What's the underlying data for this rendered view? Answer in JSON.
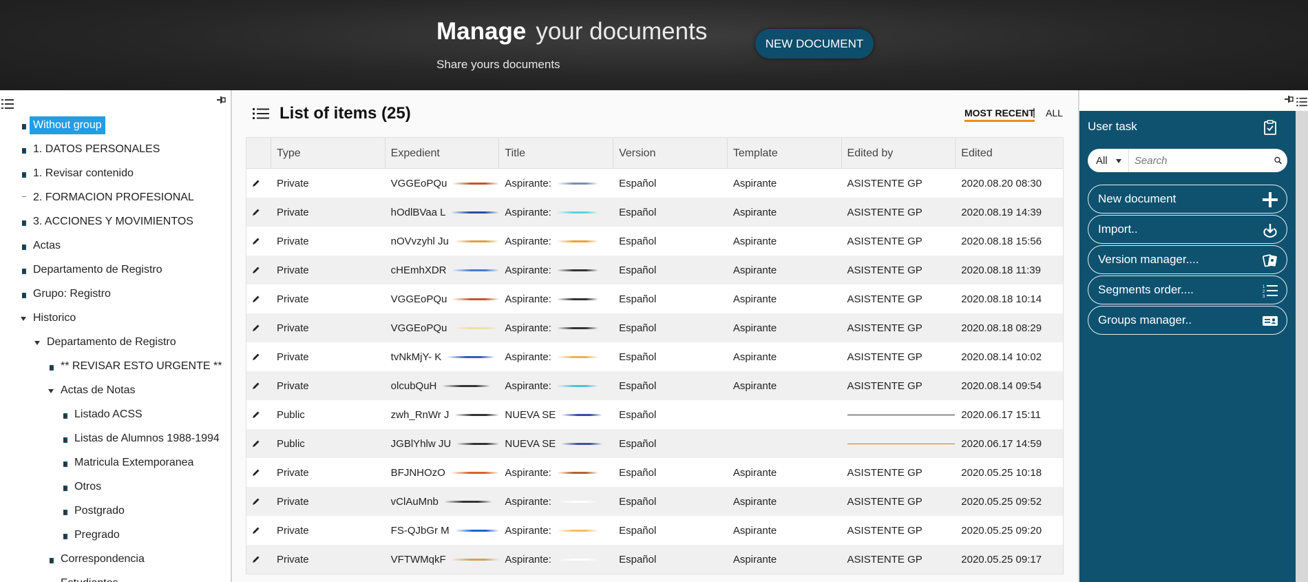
{
  "header": {
    "title_bold": "Manage",
    "title_rest": "your documents",
    "subtitle": "Share yours documents",
    "new_document_label": "NEW DOCUMENT"
  },
  "tree": [
    {
      "label": "Without group",
      "twisty": "right",
      "level": 0,
      "selected": true
    },
    {
      "label": "1. DATOS PERSONALES",
      "twisty": "right",
      "level": 0
    },
    {
      "label": "1. Revisar contenido",
      "twisty": "right",
      "level": 0
    },
    {
      "label": "2. FORMACION PROFESIONAL",
      "twisty": "dash",
      "level": 0
    },
    {
      "label": "3. ACCIONES Y MOVIMIENTOS",
      "twisty": "right",
      "level": 0
    },
    {
      "label": "Actas",
      "twisty": "right",
      "level": 0
    },
    {
      "label": "Departamento de Registro",
      "twisty": "right",
      "level": 0
    },
    {
      "label": "Grupo: Registro",
      "twisty": "right",
      "level": 0
    },
    {
      "label": "Historico",
      "twisty": "down",
      "level": 0
    },
    {
      "label": "Departamento de Registro",
      "twisty": "down",
      "level": 1
    },
    {
      "label": "** REVISAR ESTO URGENTE **",
      "twisty": "right",
      "level": 2
    },
    {
      "label": "Actas de Notas",
      "twisty": "down",
      "level": 2
    },
    {
      "label": "Listado ACSS",
      "twisty": "right",
      "level": 3
    },
    {
      "label": "Listas de Alumnos 1988-1994",
      "twisty": "right",
      "level": 3
    },
    {
      "label": "Matricula Extemporanea",
      "twisty": "right",
      "level": 3
    },
    {
      "label": "Otros",
      "twisty": "right",
      "level": 3
    },
    {
      "label": "Postgrado",
      "twisty": "right",
      "level": 3
    },
    {
      "label": "Pregrado",
      "twisty": "right",
      "level": 3
    },
    {
      "label": "Correspondencia",
      "twisty": "right",
      "level": 2
    },
    {
      "label": "Estudiantes",
      "twisty": "right",
      "level": 2
    }
  ],
  "list": {
    "title": "List of items (25)",
    "filter_recent": "MOST RECENT",
    "filter_sep": "|",
    "filter_all": "ALL",
    "columns": [
      "",
      "Type",
      "Expedient",
      "Title",
      "Version",
      "Template",
      "Edited by",
      "Edited"
    ],
    "rows": [
      {
        "type": "Private",
        "expedient": "VGGEoPQu",
        "title": "Aspirante:",
        "version": "Español",
        "template": "Aspirante",
        "edited_by": "ASISTENTE GP",
        "edited": "2020.08.20 08:30"
      },
      {
        "type": "Private",
        "expedient": "hOdlBVaa L",
        "title": "Aspirante:",
        "version": "Español",
        "template": "Aspirante",
        "edited_by": "ASISTENTE GP",
        "edited": "2020.08.19 14:39"
      },
      {
        "type": "Private",
        "expedient": "nOVvzyhl Ju",
        "title": "Aspirante:",
        "version": "Español",
        "template": "Aspirante",
        "edited_by": "ASISTENTE GP",
        "edited": "2020.08.18 15:56"
      },
      {
        "type": "Private",
        "expedient": "cHEmhXDR",
        "title": "Aspirante:",
        "version": "Español",
        "template": "Aspirante",
        "edited_by": "ASISTENTE GP",
        "edited": "2020.08.18 11:39"
      },
      {
        "type": "Private",
        "expedient": "VGGEoPQu",
        "title": "Aspirante:",
        "version": "Español",
        "template": "Aspirante",
        "edited_by": "ASISTENTE GP",
        "edited": "2020.08.18 10:14"
      },
      {
        "type": "Private",
        "expedient": "VGGEoPQu",
        "title": "Aspirante:",
        "version": "Español",
        "template": "Aspirante",
        "edited_by": "ASISTENTE GP",
        "edited": "2020.08.18 08:29"
      },
      {
        "type": "Private",
        "expedient": "tvNkMjY- K",
        "title": "Aspirante:",
        "version": "Español",
        "template": "Aspirante",
        "edited_by": "ASISTENTE GP",
        "edited": "2020.08.14 10:02"
      },
      {
        "type": "Private",
        "expedient": "olcubQuH",
        "title": "Aspirante:",
        "version": "Español",
        "template": "Aspirante",
        "edited_by": "ASISTENTE GP",
        "edited": "2020.08.14 09:54"
      },
      {
        "type": "Public",
        "expedient": "zwh_RnWr J",
        "title": "NUEVA SE",
        "version": "Español",
        "template": "",
        "edited_by": "",
        "edited": "2020.06.17 15:11"
      },
      {
        "type": "Public",
        "expedient": "JGBlYhlw JU",
        "title": "NUEVA SE",
        "version": "Español",
        "template": "",
        "edited_by": "",
        "edited": "2020.06.17 14:59"
      },
      {
        "type": "Private",
        "expedient": "BFJNHOzO",
        "title": "Aspirante:",
        "version": "Español",
        "template": "Aspirante",
        "edited_by": "ASISTENTE GP",
        "edited": "2020.05.25 10:18"
      },
      {
        "type": "Private",
        "expedient": "vClAuMnb",
        "title": "Aspirante:",
        "version": "Español",
        "template": "Aspirante",
        "edited_by": "ASISTENTE GP",
        "edited": "2020.05.25 09:52"
      },
      {
        "type": "Private",
        "expedient": "FS-QJbGr M",
        "title": "Aspirante:",
        "version": "Español",
        "template": "Aspirante",
        "edited_by": "ASISTENTE GP",
        "edited": "2020.05.25 09:20"
      },
      {
        "type": "Private",
        "expedient": "VFTWMqkF",
        "title": "Aspirante:",
        "version": "Español",
        "template": "Aspirante",
        "edited_by": "ASISTENTE GP",
        "edited": "2020.05.25 09:17"
      }
    ]
  },
  "right": {
    "title": "User task",
    "select_value": "All",
    "search_placeholder": "Search",
    "buttons": [
      {
        "label": "New document",
        "icon": "plus-icon"
      },
      {
        "label": "Import..",
        "icon": "download-icon"
      },
      {
        "label": "Version manager....",
        "icon": "cards-icon"
      },
      {
        "label": "Segments order....",
        "icon": "ordered-list-icon"
      },
      {
        "label": "Groups manager..",
        "icon": "id-card-icon"
      }
    ]
  },
  "colors": {
    "accent_blue": "#0e5270",
    "selected_blue": "#1f9fe5",
    "underline_orange": "#f28b1a"
  }
}
